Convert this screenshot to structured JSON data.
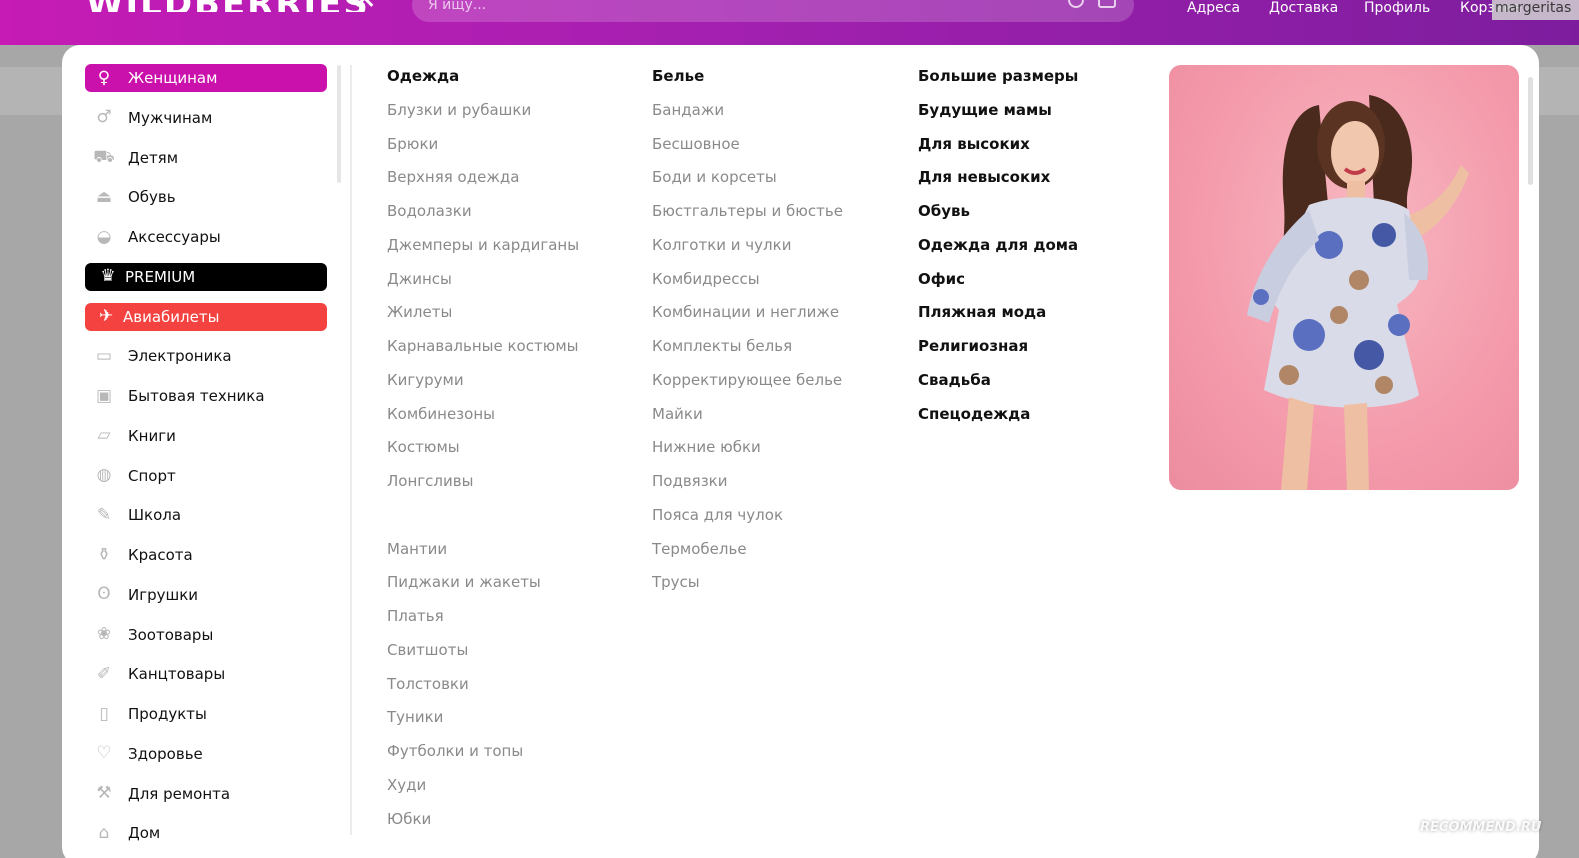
{
  "header": {
    "logo": "WILDBERRIES",
    "search_placeholder": "Я ищу...",
    "nav": [
      "Адреса",
      "Доставка",
      "Профиль",
      "Корзина"
    ],
    "username": "margeritas"
  },
  "sidebar": {
    "items": [
      {
        "label": "Женщинам",
        "icon": "woman-icon",
        "style": "active"
      },
      {
        "label": "Мужчинам",
        "icon": "man-icon",
        "style": ""
      },
      {
        "label": "Детям",
        "icon": "stroller-icon",
        "style": ""
      },
      {
        "label": "Обувь",
        "icon": "shoe-icon",
        "style": ""
      },
      {
        "label": "Аксессуары",
        "icon": "bag-icon",
        "style": ""
      },
      {
        "label": "PREMIUM",
        "icon": "crown-icon",
        "style": "premium"
      },
      {
        "label": "Авиабилеты",
        "icon": "plane-icon",
        "style": "avia"
      },
      {
        "label": "Электроника",
        "icon": "electronics-icon",
        "style": ""
      },
      {
        "label": "Бытовая техника",
        "icon": "appliance-icon",
        "style": ""
      },
      {
        "label": "Книги",
        "icon": "book-icon",
        "style": ""
      },
      {
        "label": "Спорт",
        "icon": "ball-icon",
        "style": ""
      },
      {
        "label": "Школа",
        "icon": "school-icon",
        "style": ""
      },
      {
        "label": "Красота",
        "icon": "cosmetics-icon",
        "style": ""
      },
      {
        "label": "Игрушки",
        "icon": "teddy-bear-icon",
        "style": ""
      },
      {
        "label": "Зоотовары",
        "icon": "paw-icon",
        "style": ""
      },
      {
        "label": "Канцтовары",
        "icon": "stationery-icon",
        "style": ""
      },
      {
        "label": "Продукты",
        "icon": "grocery-icon",
        "style": ""
      },
      {
        "label": "Здоровье",
        "icon": "heart-icon",
        "style": ""
      },
      {
        "label": "Для ремонта",
        "icon": "drill-icon",
        "style": ""
      },
      {
        "label": "Дом",
        "icon": "home-icon",
        "style": ""
      }
    ]
  },
  "columns": {
    "clothing": {
      "heading": "Одежда",
      "items": [
        "Блузки и рубашки",
        "Брюки",
        "Верхняя одежда",
        "Водолазки",
        "Джемперы и кардиганы",
        "Джинсы",
        "Жилеты",
        "Карнавальные костюмы",
        "Кигуруми",
        "Комбинезоны",
        "Костюмы",
        "Лонгсливы"
      ],
      "items2": [
        "Мантии",
        "Пиджаки и жакеты",
        "Платья",
        "Свитшоты",
        "Толстовки",
        "Туники",
        "Футболки и топы",
        "Худи",
        "Юбки"
      ]
    },
    "underwear": {
      "heading": "Белье",
      "items": [
        "Бандажи",
        "Бесшовное",
        "Боди и корсеты",
        "Бюстгальтеры и бюстье",
        "Колготки и чулки",
        "Комбидрессы",
        "Комбинации и неглиже",
        "Комплекты белья",
        "Корректирующее белье",
        "Майки",
        "Нижние юбки",
        "Подвязки",
        "Пояса для чулок",
        "Термобелье",
        "Трусы"
      ]
    },
    "special": {
      "items": [
        "Большие размеры",
        "Будущие мамы",
        "Для высоких",
        "Для невысоких",
        "Обувь",
        "Одежда для дома",
        "Офис",
        "Пляжная мода",
        "Религиозная",
        "Свадьба",
        "Спецодежда"
      ]
    }
  },
  "watermark": "RECOMMEND.RU",
  "colors": {
    "brand_start": "#c61bb5",
    "brand_end": "#7d1d9e",
    "active_item": "#cb11ab",
    "premium": "#000000",
    "avia": "#f3423f"
  }
}
